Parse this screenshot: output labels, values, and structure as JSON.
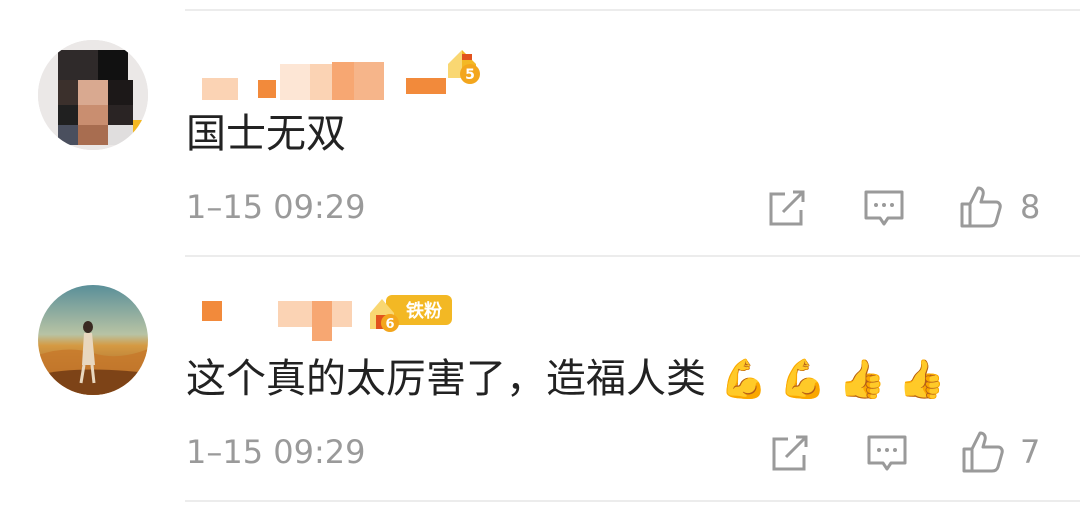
{
  "comments": [
    {
      "text": "国士无双",
      "time": "1–15 09:29",
      "likes": "8",
      "badge_level": "5",
      "avatar": "pixelated-portrait"
    },
    {
      "text": "这个真的太厉害了，造福人类",
      "emojis": [
        "💪",
        "💪",
        "👍",
        "👍"
      ],
      "time": "1–15 09:29",
      "likes": "7",
      "badge_level": "6",
      "badge_label": "铁粉",
      "avatar": "person-in-field"
    }
  ],
  "colors": {
    "blur_orange": "#f28a3b",
    "blur_light": "#fbd3b4",
    "badge_gold": "#f3b824",
    "meta_gray": "#9a9a9a",
    "divider": "#ececec"
  }
}
